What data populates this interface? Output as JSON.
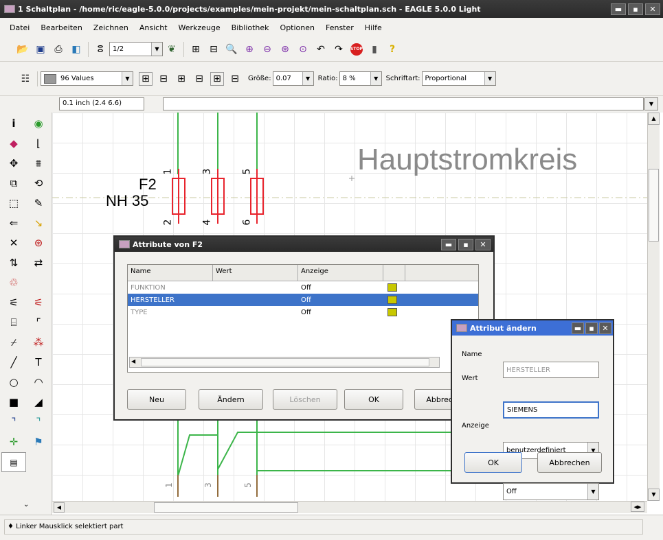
{
  "window": {
    "title": "1 Schaltplan - /home/ric/eagle-5.0.0/projects/examples/mein-projekt/mein-schaltplan.sch - EAGLE 5.0.0 Light"
  },
  "menu": [
    "Datei",
    "Bearbeiten",
    "Zeichnen",
    "Ansicht",
    "Werkzeuge",
    "Bibliothek",
    "Optionen",
    "Fenster",
    "Hilfe"
  ],
  "toolbar": {
    "zoom_value": "1/2"
  },
  "param_bar": {
    "values_label": "96 Values",
    "groesse_label": "Größe:",
    "groesse_value": "0.07",
    "ratio_label": "Ratio:",
    "ratio_value": "8 %",
    "schriftart_label": "Schriftart:",
    "schriftart_value": "Proportional"
  },
  "coord_bar": {
    "coords": "0.1 inch (2.4 6.6)"
  },
  "schematic": {
    "heading": "Hauptstromkreis",
    "part_name": "F2",
    "part_value": "NH 35",
    "pins_top": [
      "1",
      "3",
      "5"
    ],
    "pins_bottom": [
      "2",
      "4",
      "6"
    ],
    "pins_lower": [
      "1",
      "3",
      "5"
    ]
  },
  "attr_dialog": {
    "title": "Attribute von F2",
    "columns": [
      "Name",
      "Wert",
      "Anzeige"
    ],
    "rows": [
      {
        "name": "FUNKTION",
        "wert": "",
        "anzeige": "Off"
      },
      {
        "name": "HERSTELLER",
        "wert": "",
        "anzeige": "Off"
      },
      {
        "name": "TYPE",
        "wert": "",
        "anzeige": "Off"
      }
    ],
    "btn_neu": "Neu",
    "btn_aendern": "Ändern",
    "btn_loeschen": "Löschen",
    "btn_ok": "OK",
    "btn_abbrechen": "Abbrechen"
  },
  "change_dialog": {
    "title": "Attribut ändern",
    "name_label": "Name",
    "name_value": "HERSTELLER",
    "wert_label": "Wert",
    "wert_value": "SIEMENS",
    "mode_value": "benutzerdefiniert",
    "anzeige_label": "Anzeige",
    "anzeige_value": "Off",
    "btn_ok": "OK",
    "btn_abbrechen": "Abbrechen"
  },
  "status": {
    "text": "♦ Linker Mausklick selektiert part"
  },
  "colors": {
    "title_bg": "#2e2e2e",
    "selection": "#3d73c9",
    "wire": "#3cb54a",
    "part": "#e8242d"
  }
}
